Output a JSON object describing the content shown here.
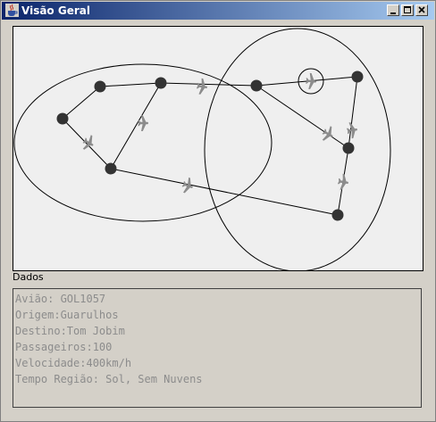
{
  "window": {
    "title": "Visão Geral",
    "buttons": [
      "minimize",
      "maximize",
      "close"
    ]
  },
  "map": {
    "icons": {
      "node": "circle-node-icon",
      "airplane": "airplane-icon",
      "selected": "selected-airplane-icon"
    },
    "colors": {
      "line": "#000000",
      "node": "#333333",
      "airplane": "#8c8c8c",
      "background": "#efefef"
    }
  },
  "details": {
    "label": "Dados",
    "lines": [
      "Avião: GOL1057",
      "Origem:Guarulhos",
      "Destino:Tom Jobim",
      "Passageiros:100",
      "Velocidade:400km/h",
      "Tempo Região: Sol, Sem Nuvens"
    ]
  }
}
